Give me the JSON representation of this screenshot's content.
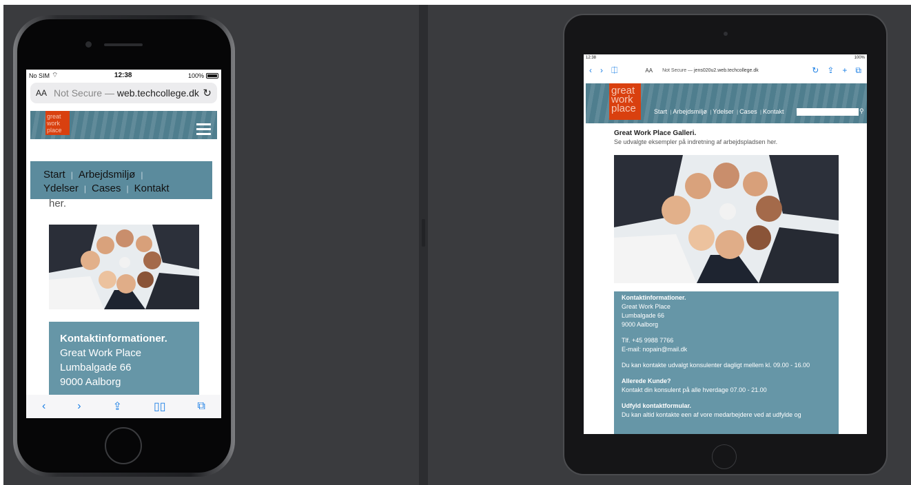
{
  "phone": {
    "status": {
      "carrier": "No SIM",
      "time": "12:38",
      "battery": "100%"
    },
    "urlbar": {
      "aa": "AA",
      "security": "Not Secure —",
      "host": "web.techcollege.dk"
    },
    "logo": {
      "line1": "great",
      "line2": "work",
      "line3": "place"
    },
    "text_behind": "her.",
    "menu": {
      "items": [
        "Start",
        "Arbejdsmiljø",
        "Ydelser",
        "Cases",
        "Kontakt"
      ],
      "sep": "|"
    },
    "contact": {
      "title": "Kontaktinformationer.",
      "lines": [
        "Great Work Place",
        "Lumbalgade 66",
        "9000 Aalborg"
      ]
    }
  },
  "ipad": {
    "status": {
      "time": "12:38",
      "battery": "100%"
    },
    "urlbar": {
      "aa": "AA",
      "security": "Not Secure —",
      "host": "jens020u2.web.techcollege.dk"
    },
    "logo": {
      "line1": "great",
      "line2": "work",
      "line3": "place"
    },
    "nav": {
      "items": [
        "Start",
        "Arbejdsmiljø",
        "Ydelser",
        "Cases",
        "Kontakt"
      ],
      "sep": "|"
    },
    "gallery": {
      "title": "Great Work Place Galleri.",
      "subtitle": "Se udvalgte eksempler på indretning af arbejdspladsen her."
    },
    "contact": {
      "title": "Kontaktinformationer.",
      "address": [
        "Great Work Place",
        "Lumbalgade 66",
        "9000 Aalborg"
      ],
      "phone": "Tlf. +45 9988 7766",
      "email": "E-mail: nopain@mail.dk",
      "hours": "Du kan kontakte udvalgt konsulenter dagligt mellem kl. 09.00 - 16.00",
      "customer_title": "Allerede Kunde?",
      "customer_text": "Kontakt din konsulent på alle hverdage 07.00 - 21.00",
      "form_title": "Udfyld kontaktformular.",
      "form_text": "Du kan altid kontakte een af vore medarbejdere ved at udfylde og"
    }
  },
  "colors": {
    "header": "#4f7e8e",
    "logo": "#d9400f",
    "contact_box": "#6696a7",
    "ios_blue": "#1b7fe5"
  }
}
